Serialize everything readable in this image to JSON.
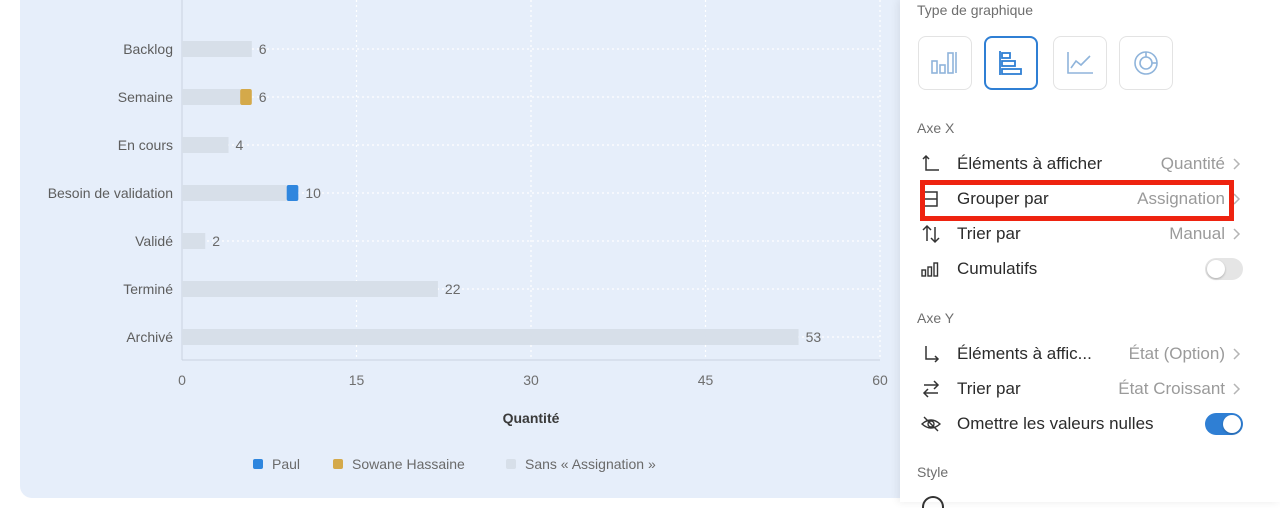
{
  "chart_data": {
    "type": "bar",
    "orientation": "horizontal",
    "stacked": true,
    "categories": [
      "Backlog",
      "Semaine",
      "En cours",
      "Besoin de validation",
      "Validé",
      "Terminé",
      "Archivé"
    ],
    "series": [
      {
        "name": "Paul",
        "color": "#2f86de",
        "values": [
          0,
          0,
          0,
          1,
          0,
          0,
          0
        ]
      },
      {
        "name": "Sowane Hassaine",
        "color": "#d4a94a",
        "values": [
          0,
          1,
          0,
          0,
          0,
          0,
          0
        ]
      },
      {
        "name": "Sans « Assignation »",
        "color": "#d7dfe9",
        "values": [
          6,
          5,
          4,
          9,
          2,
          22,
          53
        ]
      }
    ],
    "totals": [
      6,
      6,
      4,
      10,
      2,
      22,
      53
    ],
    "xlabel": "Quantité",
    "xlim": [
      0,
      60
    ],
    "xticks": [
      0,
      15,
      30,
      45,
      60
    ],
    "grid": true,
    "legend_position": "bottom"
  },
  "panel": {
    "chart_type_title": "Type de graphique",
    "chart_types": [
      {
        "name": "vertical-bar",
        "selected": false
      },
      {
        "name": "horizontal-bar",
        "selected": true
      },
      {
        "name": "line",
        "selected": false
      },
      {
        "name": "donut",
        "selected": false
      }
    ],
    "axis_x_title": "Axe X",
    "axis_x": {
      "elements_label": "Éléments à afficher",
      "elements_value": "Quantité",
      "group_label": "Grouper par",
      "group_value": "Assignation",
      "sort_label": "Trier par",
      "sort_value": "Manual",
      "cumulative_label": "Cumulatifs",
      "cumulative_on": false
    },
    "axis_y_title": "Axe Y",
    "axis_y": {
      "elements_label": "Éléments à affic...",
      "elements_value": "État (Option)",
      "sort_label": "Trier par",
      "sort_value": "État Croissant",
      "omit_label": "Omettre les valeurs nulles",
      "omit_on": true
    },
    "style_title": "Style"
  },
  "colors": {
    "accent": "#2f7fd4",
    "highlight": "#ee2310",
    "chart_bg": "#e6eefa"
  }
}
